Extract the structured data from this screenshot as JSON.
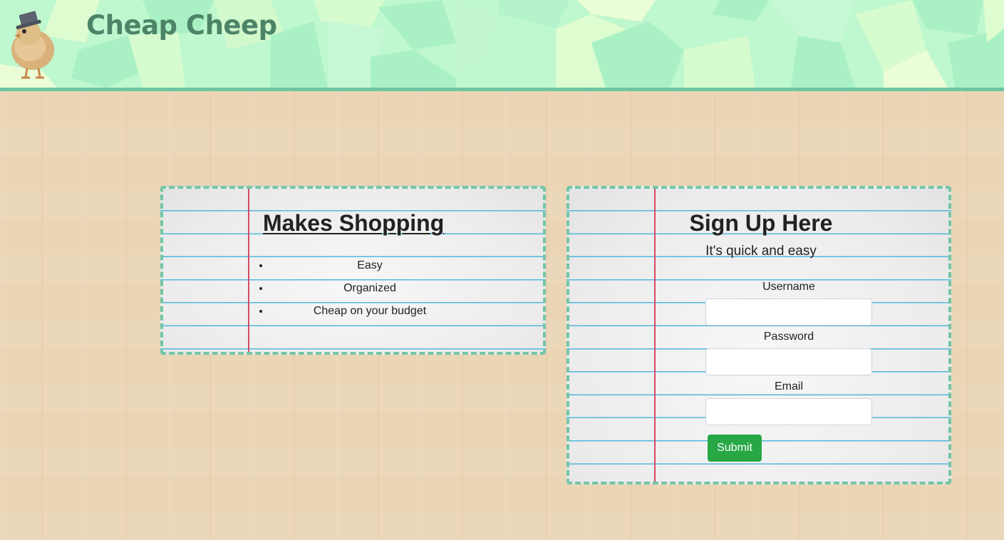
{
  "header": {
    "site_title": "Cheap Cheep",
    "logo_icon": "chick-with-top-hat-icon"
  },
  "features": {
    "title": "Makes Shopping",
    "items": [
      "Easy",
      "Organized",
      "Cheap on your budget"
    ]
  },
  "signup": {
    "title": "Sign Up Here",
    "subtitle": "It's quick and easy",
    "fields": {
      "username": {
        "label": "Username",
        "value": "",
        "placeholder": ""
      },
      "password": {
        "label": "Password",
        "value": "",
        "placeholder": ""
      },
      "email": {
        "label": "Email",
        "value": "",
        "placeholder": ""
      }
    },
    "submit_label": "Submit"
  },
  "colors": {
    "header_bg": "#bff7cf",
    "header_border": "#6fc4a4",
    "title_color": "#4d8468",
    "card_border": "#73c6a6",
    "notebook_line": "#52b7dc",
    "margin_line": "#d44a64",
    "submit_bg": "#28a745",
    "wood_bg": "#ead5b5"
  }
}
